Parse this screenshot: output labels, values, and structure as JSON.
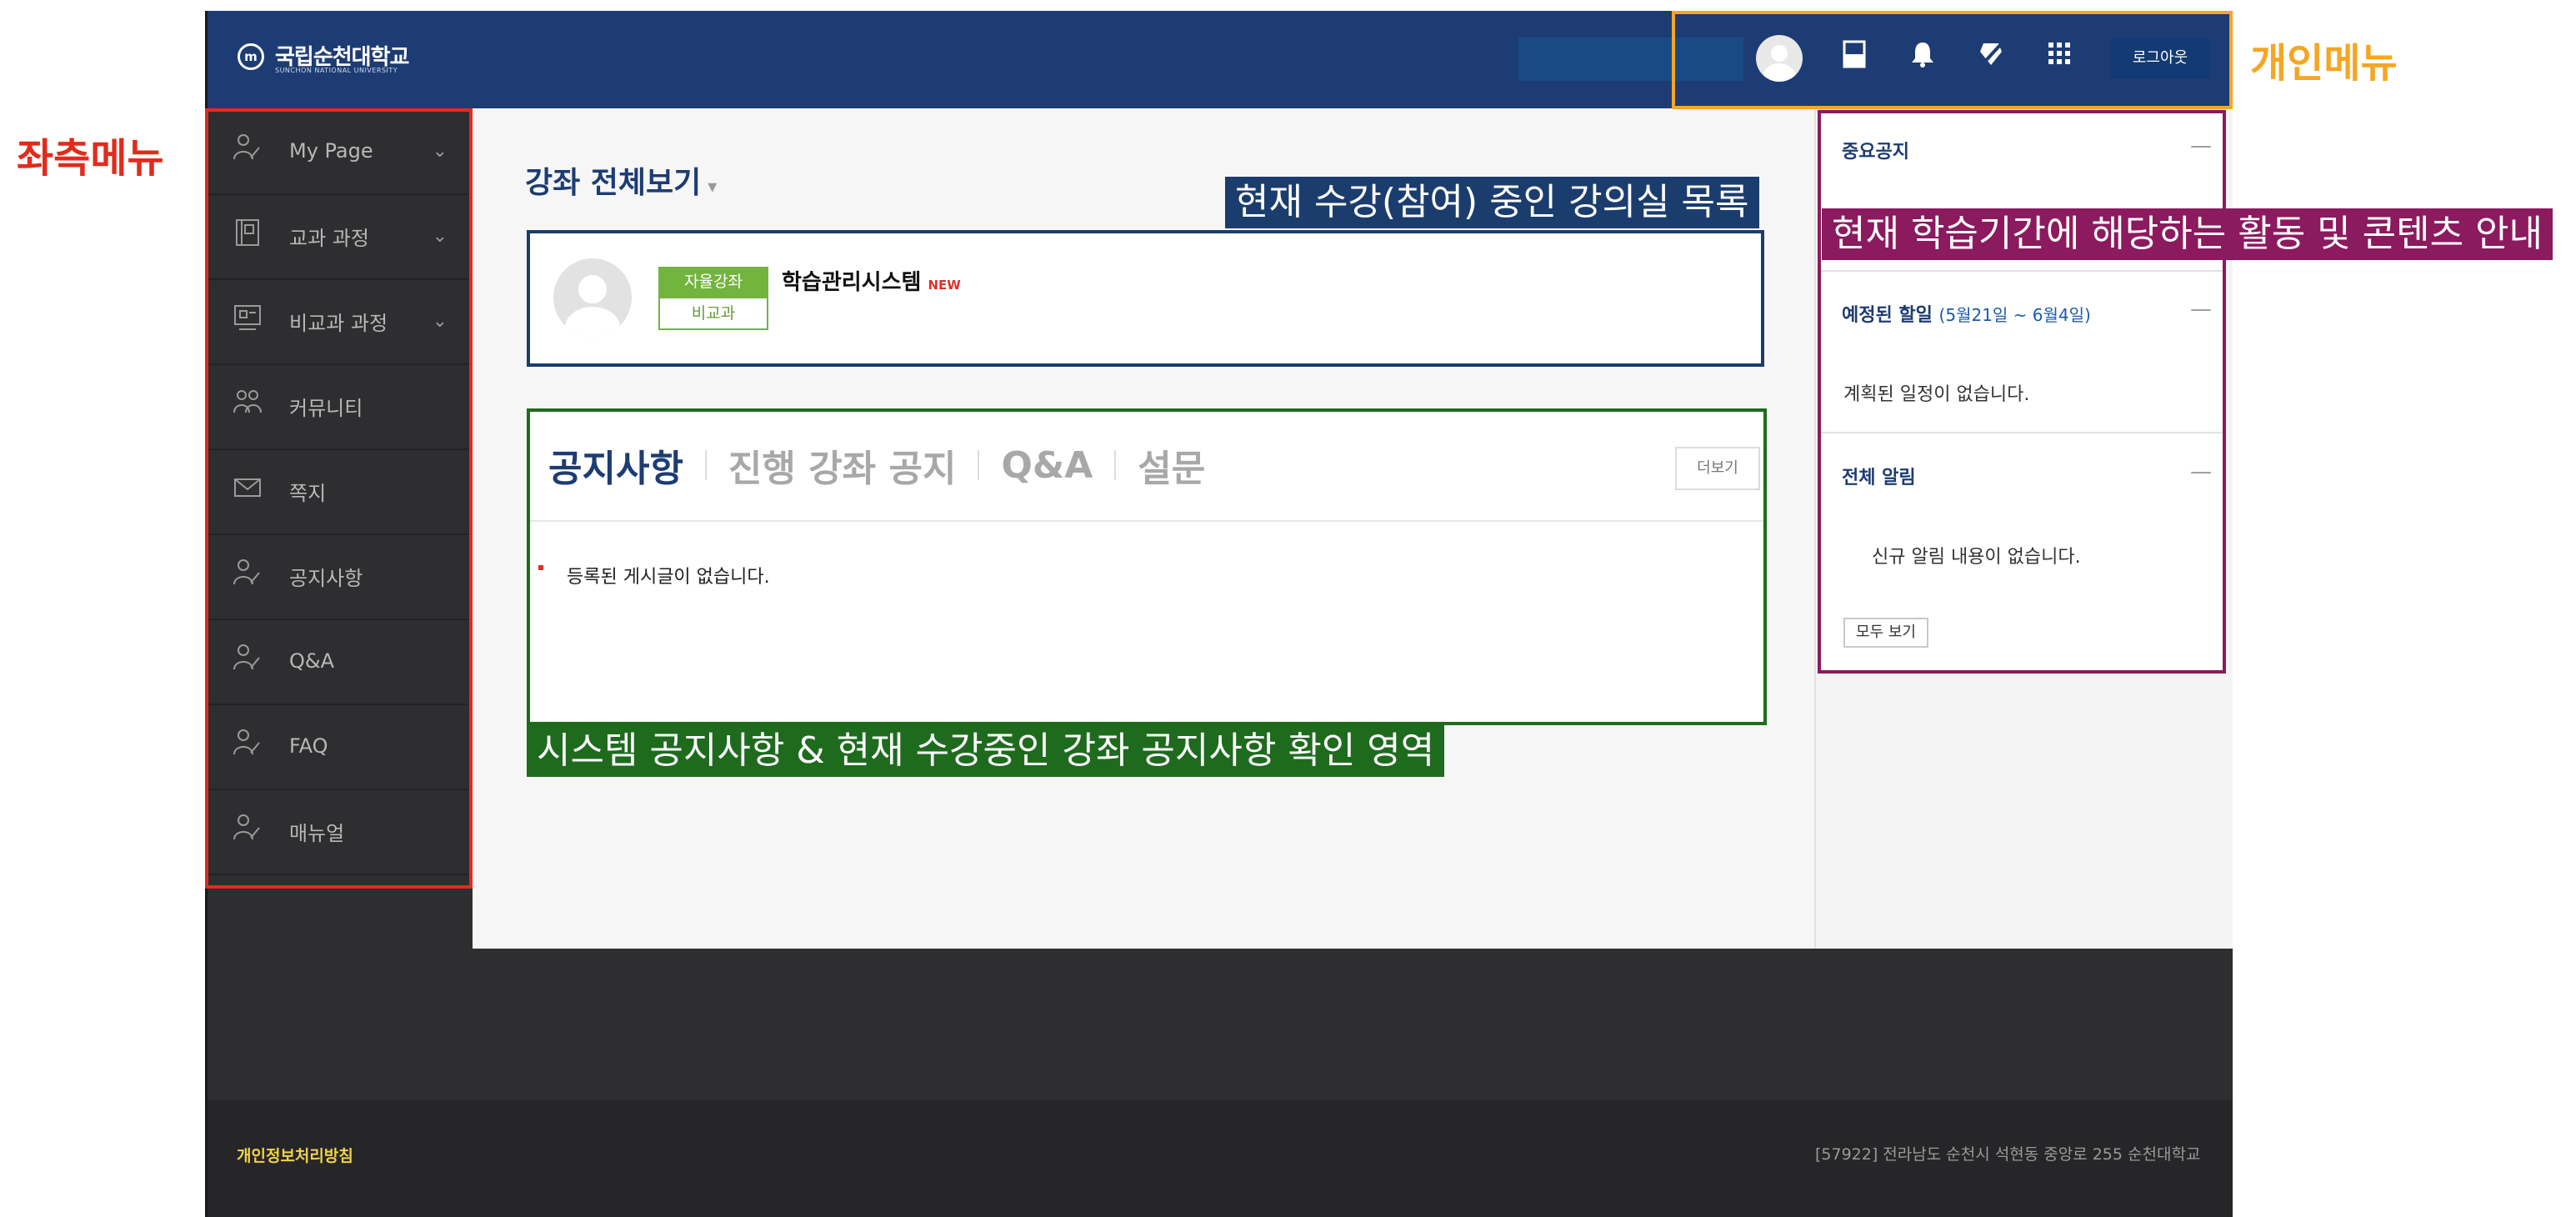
{
  "header": {
    "logo_mark": "m",
    "logo_text": "국립순천대학교",
    "logo_subtext": "SUNCHON NATIONAL UNIVERSITY",
    "icons": [
      "profile-avatar",
      "display-icon",
      "bell-icon",
      "badge-icon",
      "apps-grid-icon"
    ],
    "logout_label": "로그아웃"
  },
  "sidebar": {
    "items": [
      {
        "label": "My Page",
        "icon": "user-icon",
        "expandable": true
      },
      {
        "label": "교과 과정",
        "icon": "book-icon",
        "expandable": true
      },
      {
        "label": "비교과 과정",
        "icon": "board-icon",
        "expandable": true
      },
      {
        "label": "커뮤니티",
        "icon": "group-icon",
        "expandable": false
      },
      {
        "label": "쪽지",
        "icon": "mail-icon",
        "expandable": false
      },
      {
        "label": "공지사항",
        "icon": "user-icon",
        "expandable": false
      },
      {
        "label": "Q&A",
        "icon": "user-icon",
        "expandable": false
      },
      {
        "label": "FAQ",
        "icon": "user-icon",
        "expandable": false
      },
      {
        "label": "매뉴얼",
        "icon": "user-icon",
        "expandable": false
      }
    ]
  },
  "main": {
    "section_title": "강좌 전체보기",
    "course": {
      "tag_top": "자율강좌",
      "tag_bottom": "비교과",
      "title": "학습관리시스템",
      "new_badge": "NEW"
    },
    "notices": {
      "tabs": [
        "공지사항",
        "진행 강좌 공지",
        "Q&A",
        "설문"
      ],
      "active_tab": 0,
      "more_label": "더보기",
      "empty_text": "등록된 게시글이 없습니다."
    }
  },
  "right": {
    "important": {
      "title": "중요공지"
    },
    "schedule": {
      "title": "예정된 할일",
      "period": "(5월21일 ~ 6월4일)",
      "empty_text": "계획된 일정이 없습니다."
    },
    "alerts": {
      "title": "전체 알림",
      "empty_text": "신규 알림 내용이 없습니다.",
      "button_label": "모두 보기"
    }
  },
  "footer": {
    "privacy_link": "개인정보처리방침",
    "address": "[57922] 전라남도 순천시 석현동 중앙로 255 순천대학교"
  },
  "annotations": {
    "left_menu": "좌측메뉴",
    "personal_menu": "개인메뉴",
    "classroom_list": "현재 수강(참여) 중인 강의실 목록",
    "activity_guide": "현재 학습기간에 해당하는 활동 및 콘텐츠 안내",
    "notice_area": "시스템 공지사항 & 현재 수강중인 강좌 공지사항 확인 영역"
  },
  "colors": {
    "header_bg": "#1d3c73",
    "annotation_red": "#e22b1c",
    "annotation_orange": "#f5a623",
    "annotation_blue": "#1b3d6e",
    "annotation_purple": "#8b1a5e",
    "annotation_green": "#1e6b1e",
    "footer_link": "#f0d34a"
  }
}
